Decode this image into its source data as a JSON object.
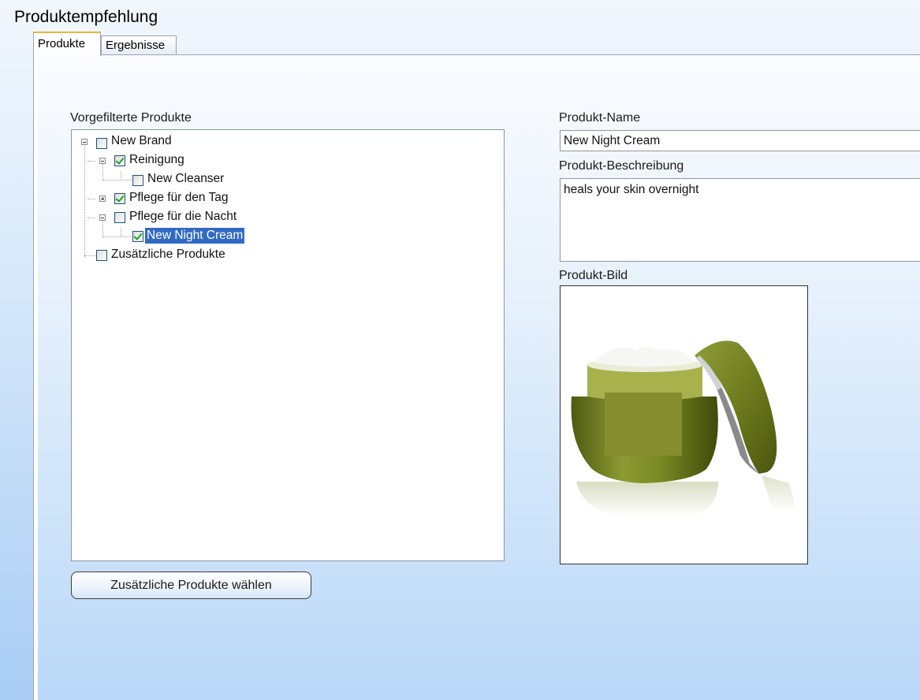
{
  "window": {
    "title": "Produktempfehlung"
  },
  "tabs": [
    {
      "label": "Produkte",
      "active": true
    },
    {
      "label": "Ergebnisse",
      "active": false
    }
  ],
  "tree": {
    "label": "Vorgefilterte Produkte",
    "nodes": [
      {
        "label": "New Brand",
        "checked": false,
        "expanded": true
      },
      {
        "label": "Reinigung",
        "checked": true,
        "expanded": true
      },
      {
        "label": "New Cleanser",
        "checked": false
      },
      {
        "label": "Pflege für den Tag",
        "checked": true,
        "expanded": false
      },
      {
        "label": "Pflege für die Nacht",
        "checked": false,
        "expanded": true
      },
      {
        "label": "New Night Cream",
        "checked": true,
        "selected": true
      },
      {
        "label": "Zusätzliche Produkte",
        "checked": false
      }
    ]
  },
  "details": {
    "name_label": "Produkt-Name",
    "name_value": "New Night Cream",
    "description_label": "Produkt-Beschreibung",
    "description_value": "heals your skin overnight",
    "image_label": "Produkt-Bild"
  },
  "buttons": {
    "additional_products": "Zusätzliche Produkte wählen"
  },
  "colors": {
    "selection": "#316ac5",
    "jar_green": "#6f7a1e",
    "label_block": "#868d2e",
    "tab_accent": "#f0b43c"
  },
  "icons": {
    "expander_minus": "minus-expander-icon",
    "expander_plus": "plus-expander-icon",
    "checkbox": "checkbox-icon"
  }
}
